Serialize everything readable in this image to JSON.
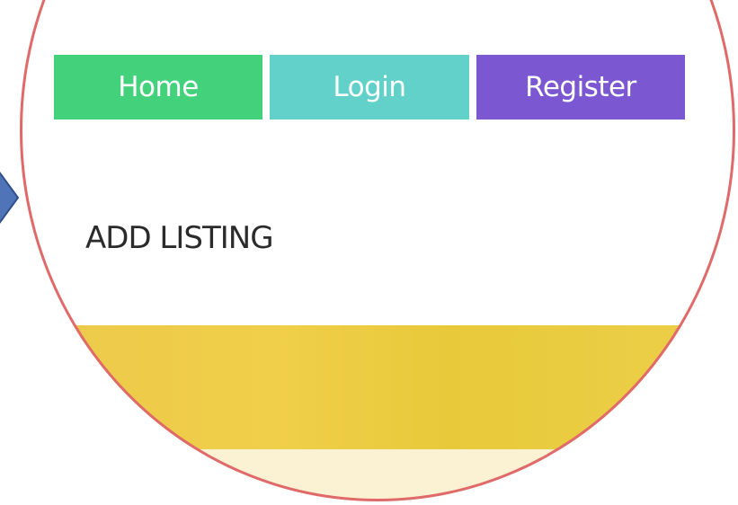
{
  "nav": {
    "home_label": "Home",
    "login_label": "Login",
    "register_label": "Register",
    "home_color": "#43d17c",
    "login_color": "#62d1ca",
    "register_color": "#7b57d1"
  },
  "page": {
    "title": "ADD LISTING"
  },
  "colors": {
    "ring": "#e06a6a",
    "pointer": "#4f74b8",
    "banner": "#ecc94b",
    "cream": "#fbf2d4"
  },
  "icons": {
    "pointer": "pointer-arrow-icon"
  }
}
